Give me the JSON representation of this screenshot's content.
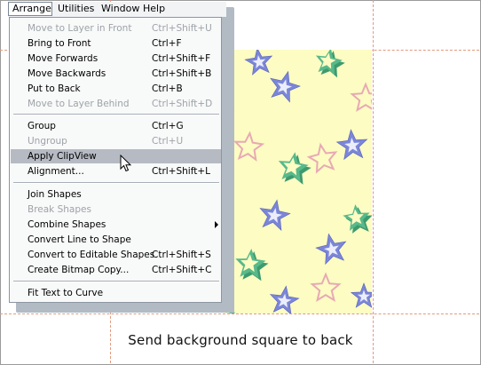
{
  "menubar": [
    "Arrange",
    "Utilities",
    "Window",
    "Help"
  ],
  "menu": {
    "groups": [
      [
        {
          "label": "Move to Layer in Front",
          "shortcut": "Ctrl+Shift+U",
          "enabled": false
        },
        {
          "label": "Bring to Front",
          "shortcut": "Ctrl+F",
          "enabled": true
        },
        {
          "label": "Move Forwards",
          "shortcut": "Ctrl+Shift+F",
          "enabled": true
        },
        {
          "label": "Move Backwards",
          "shortcut": "Ctrl+Shift+B",
          "enabled": true
        },
        {
          "label": "Put to Back",
          "shortcut": "Ctrl+B",
          "enabled": true
        },
        {
          "label": "Move to Layer Behind",
          "shortcut": "Ctrl+Shift+D",
          "enabled": false
        }
      ],
      [
        {
          "label": "Group",
          "shortcut": "Ctrl+G",
          "enabled": true
        },
        {
          "label": "Ungroup",
          "shortcut": "Ctrl+U",
          "enabled": false
        },
        {
          "label": "Apply ClipView",
          "shortcut": "",
          "enabled": true,
          "highlighted": true
        },
        {
          "label": "Alignment...",
          "shortcut": "Ctrl+Shift+L",
          "enabled": true
        }
      ],
      [
        {
          "label": "Join Shapes",
          "shortcut": "",
          "enabled": true
        },
        {
          "label": "Break Shapes",
          "shortcut": "",
          "enabled": false
        },
        {
          "label": "Combine Shapes",
          "shortcut": "",
          "enabled": true,
          "submenu": true
        },
        {
          "label": "Convert Line to Shape",
          "shortcut": "",
          "enabled": true
        },
        {
          "label": "Convert to Editable Shapes",
          "shortcut": "Ctrl+Shift+S",
          "enabled": true
        },
        {
          "label": "Create Bitmap Copy...",
          "shortcut": "Ctrl+Shift+C",
          "enabled": true
        }
      ],
      [
        {
          "label": "Fit Text to Curve",
          "shortcut": "",
          "enabled": true
        }
      ]
    ]
  },
  "caption": "Send background square to back",
  "colors": {
    "pattern_bg": "#fcfcc3",
    "star_blue": "#7b86d9",
    "star_green": "#58b98a",
    "star_pink": "#e8a9b4",
    "guide": "#e39a7c",
    "highlight": "#b6bac3"
  }
}
